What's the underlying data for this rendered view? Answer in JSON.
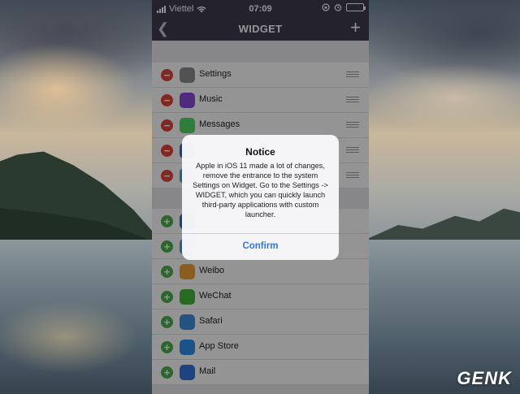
{
  "status_bar": {
    "carrier": "Viettel",
    "time": "07:09"
  },
  "nav": {
    "title": "WIDGET",
    "back_icon": "chevron-left-icon",
    "add_icon": "plus-icon"
  },
  "enabled_widgets": [
    {
      "label": "Settings",
      "icon": "gear-icon",
      "color": "#8e8e93"
    },
    {
      "label": "Music",
      "icon": "music-note-icon",
      "color": "#8a4ad8"
    },
    {
      "label": "Messages",
      "icon": "message-bubble-icon",
      "color": "#4cd964"
    },
    {
      "label": "",
      "icon": "app-icon",
      "color": "#2f6fd0"
    },
    {
      "label": "",
      "icon": "app-icon",
      "color": "#35a7e0"
    }
  ],
  "available_widgets": [
    {
      "label": "",
      "icon": "app-icon",
      "color": "#2f6fd0"
    },
    {
      "label": "",
      "icon": "app-icon",
      "color": "#35a7e0"
    },
    {
      "label": "Weibo",
      "icon": "weibo-icon",
      "color": "#f0a236"
    },
    {
      "label": "WeChat",
      "icon": "wechat-icon",
      "color": "#43b83a"
    },
    {
      "label": "Safari",
      "icon": "compass-icon",
      "color": "#3e8ee0"
    },
    {
      "label": "App Store",
      "icon": "app-store-icon",
      "color": "#2f8ee8"
    },
    {
      "label": "Mail",
      "icon": "envelope-icon",
      "color": "#3474e0"
    }
  ],
  "alert": {
    "title": "Notice",
    "message": "Apple in iOS 11 made a lot of changes, remove the entrance to the system Settings on Widget. Go to the Settings -> WIDGET, which you can quickly launch third-party applications with custom launcher.",
    "button": "Confirm"
  },
  "watermark": "GENK",
  "colors": {
    "nav_bg": "#3e3c4d",
    "remove": "#e0443b",
    "add": "#4caf4f",
    "alert_button": "#2d7ad6"
  }
}
